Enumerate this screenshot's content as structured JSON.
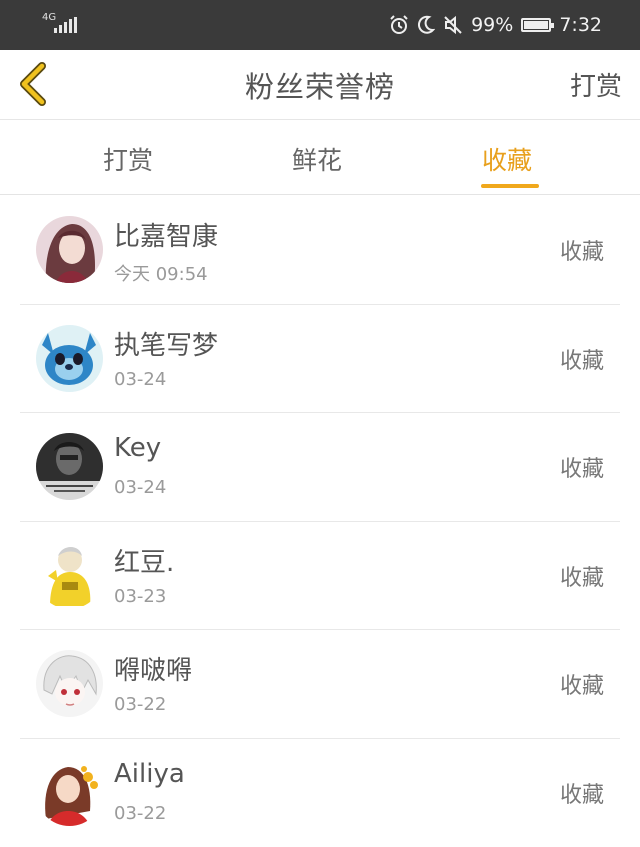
{
  "status_bar": {
    "network": "4G",
    "battery": "99%",
    "time": "7:32"
  },
  "nav": {
    "title": "粉丝荣誉榜",
    "right_label": "打赏"
  },
  "tabs": [
    {
      "label": "打赏",
      "active": false
    },
    {
      "label": "鲜花",
      "active": false
    },
    {
      "label": "收藏",
      "active": true
    }
  ],
  "colors": {
    "accent": "#f0a81c",
    "status_bar_bg": "#3a3a3a",
    "text_primary": "#555555",
    "text_secondary": "#9a9a9a"
  },
  "fans": [
    {
      "name": "比嘉智康",
      "time": "今天 09:54",
      "action": "收藏"
    },
    {
      "name": "执笔写梦",
      "time": "03-24",
      "action": "收藏"
    },
    {
      "name": "Key",
      "time": "03-24",
      "action": "收藏"
    },
    {
      "name": "红豆.",
      "time": "03-23",
      "action": "收藏"
    },
    {
      "name": "嘚啵嘚",
      "time": "03-22",
      "action": "收藏"
    },
    {
      "name": "Ailiya",
      "time": "03-22",
      "action": "收藏"
    }
  ]
}
